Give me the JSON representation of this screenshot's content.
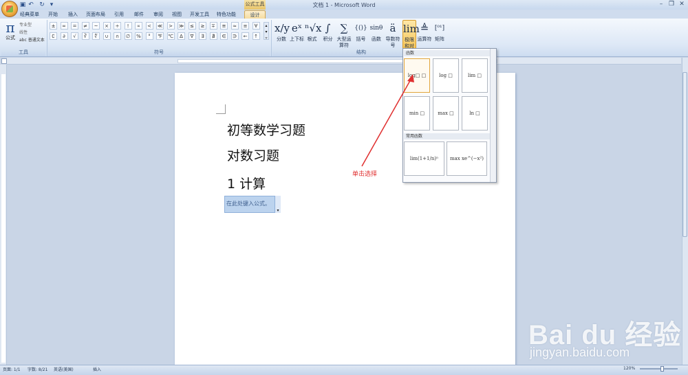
{
  "window": {
    "title": "文档 1 - Microsoft Word",
    "context_tab_header": "公式工具"
  },
  "tabs": [
    "经典菜单",
    "开始",
    "插入",
    "页面布局",
    "引用",
    "邮件",
    "审阅",
    "视图",
    "开发工具",
    "特色功能",
    "设计"
  ],
  "ribbon": {
    "tools_group": {
      "label": "工具",
      "formula_button": "公式",
      "professional": "专业型",
      "linear": "线性",
      "normal_text": "abc 普通文本"
    },
    "symbols_group": {
      "label": "符号",
      "row1": [
        "±",
        "∞",
        "=",
        "≠",
        "~",
        "×",
        "÷",
        "!",
        "∝",
        "<",
        "≪",
        ">",
        "≫",
        "≤",
        "≥",
        "∓",
        "≅",
        "≈",
        "≡",
        "∀"
      ],
      "row2": [
        "∁",
        "∂",
        "√",
        "∛",
        "∜",
        "∪",
        "∩",
        "∅",
        "%",
        "°",
        "℉",
        "℃",
        "∆",
        "∇",
        "∃",
        "∄",
        "∈",
        "∋",
        "←",
        "↑"
      ]
    },
    "structures_group": {
      "label": "结构",
      "buttons": [
        {
          "glyph": "x/y",
          "label": "分数"
        },
        {
          "glyph": "eˣ",
          "label": "上下标"
        },
        {
          "glyph": "ⁿ√x",
          "label": "根式"
        },
        {
          "glyph": "∫",
          "label": "积分"
        },
        {
          "glyph": "∑",
          "label": "大型运算符"
        },
        {
          "glyph": "{()}",
          "label": "括号"
        },
        {
          "glyph": "sinθ",
          "label": "函数"
        },
        {
          "glyph": "ä",
          "label": "导数符号"
        },
        {
          "glyph": "lim",
          "label": "极限和对数"
        },
        {
          "glyph": "≜",
          "label": "运算符"
        },
        {
          "glyph": "[⁰¹]",
          "label": "矩阵"
        }
      ]
    }
  },
  "gallery": {
    "section1": "函数",
    "items1": [
      "log□ □",
      "log □",
      "lim □",
      "min □",
      "max □",
      "ln □"
    ],
    "section2": "常用函数",
    "items2": [
      "lim(1+1/n)ⁿ",
      "max xe^(−x²)"
    ]
  },
  "document": {
    "lines": [
      "初等数学习题",
      "对数习题",
      "1 计算"
    ],
    "equation_placeholder": "在此处键入公式。"
  },
  "annotation": "单击选择",
  "statusbar": {
    "page": "页面: 1/1",
    "words": "字数: 8/21",
    "language": "英语(美国)",
    "mode": "插入",
    "zoom": "120%"
  },
  "watermark": {
    "logo": "Bai du 经验",
    "url": "jingyan.baidu.com"
  },
  "colors": {
    "ribbon_bg": "#dde8f6",
    "accent_orange": "#f7c75b",
    "annotation_red": "#e03030"
  }
}
